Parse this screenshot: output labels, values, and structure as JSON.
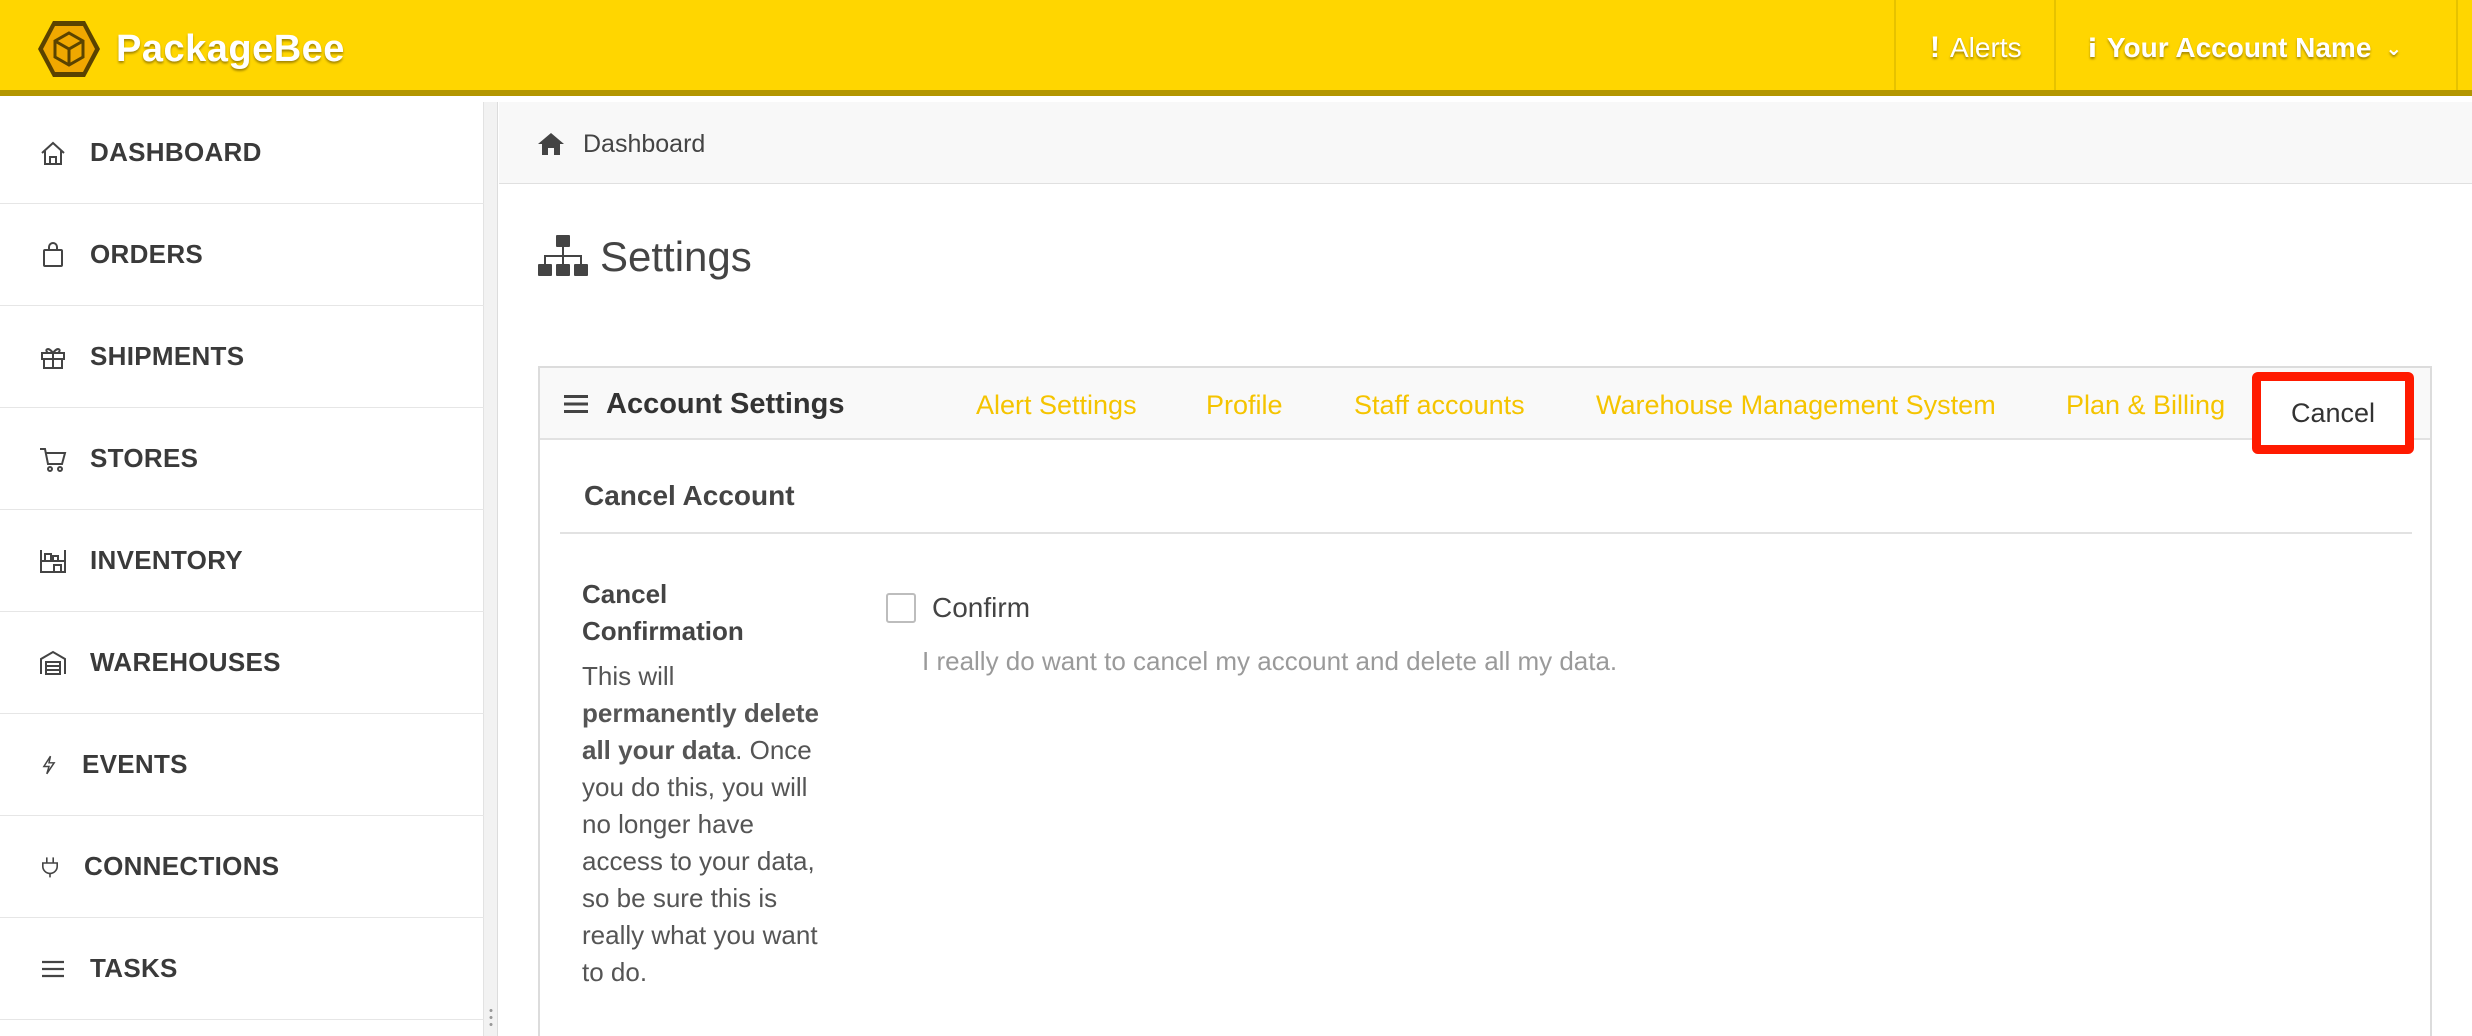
{
  "app": {
    "name": "PackageBee"
  },
  "header": {
    "alerts_label": "Alerts",
    "account_label": "Your Account Name"
  },
  "sidebar": {
    "items": [
      {
        "label": "DASHBOARD",
        "icon": "home-icon"
      },
      {
        "label": "ORDERS",
        "icon": "bag-icon"
      },
      {
        "label": "SHIPMENTS",
        "icon": "gift-box-icon"
      },
      {
        "label": "STORES",
        "icon": "cart-icon"
      },
      {
        "label": "INVENTORY",
        "icon": "shelves-icon"
      },
      {
        "label": "WAREHOUSES",
        "icon": "warehouse-icon"
      },
      {
        "label": "EVENTS",
        "icon": "lightning-icon"
      },
      {
        "label": "CONNECTIONS",
        "icon": "plug-icon"
      },
      {
        "label": "TASKS",
        "icon": "list-icon"
      }
    ]
  },
  "breadcrumb": {
    "label": "Dashboard"
  },
  "page": {
    "title": "Settings"
  },
  "panel": {
    "title": "Account Settings",
    "tabs": [
      {
        "label": "Alert Settings"
      },
      {
        "label": "Profile"
      },
      {
        "label": "Staff accounts"
      },
      {
        "label": "Warehouse Management System"
      },
      {
        "label": "Plan & Billing"
      }
    ],
    "active_tab": "Cancel",
    "section_title": "Cancel Account",
    "field_label": "Cancel Confirmation",
    "help_intro": "This will ",
    "help_bold": "permanently delete all your data",
    "help_rest": ". Once you do this, you will no longer have access to your data, so be sure this is really what you want to do.",
    "checkbox_label": "Confirm",
    "checkbox_checked": false,
    "checkbox_description": "I really do want to cancel my account and delete all my data."
  },
  "colors": {
    "brand_yellow": "#ffd600",
    "tab_link": "#f5c400",
    "highlight_red": "#ff1a00"
  }
}
